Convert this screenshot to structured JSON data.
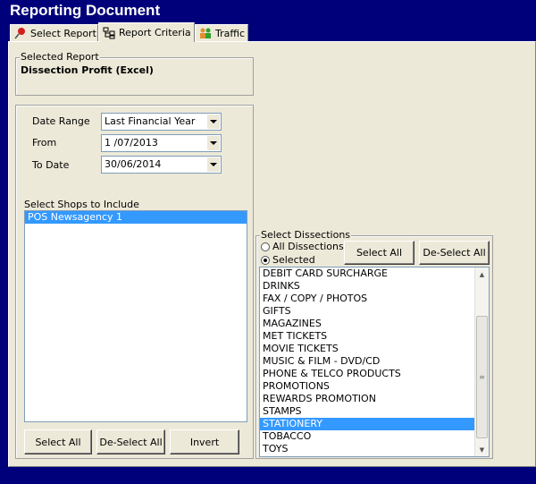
{
  "window": {
    "title": "Reporting Document"
  },
  "tabs": [
    {
      "label": "Select Report",
      "icon": "pin-icon"
    },
    {
      "label": "Report Criteria",
      "icon": "tree-icon"
    },
    {
      "label": "Traffic",
      "icon": "people-icon"
    }
  ],
  "active_tab": "Report Criteria",
  "selected_report": {
    "legend": "Selected Report",
    "name": "Dissection Profit (Excel)"
  },
  "criteria": {
    "date_range": {
      "label": "Date Range",
      "value": "Last Financial Year"
    },
    "from": {
      "label": "From",
      "value": "1 /07/2013"
    },
    "to_date": {
      "label": "To Date",
      "value": "30/06/2014"
    }
  },
  "shops": {
    "label": "Select Shops to Include",
    "items": [
      "POS Newsagency 1"
    ],
    "selected": "POS Newsagency 1",
    "buttons": {
      "select_all": "Select All",
      "deselect_all": "De-Select All",
      "invert": "Invert"
    }
  },
  "dissections": {
    "legend": "Select Dissections",
    "radio_all": "All Dissections",
    "radio_selected": "Selected",
    "radio_value": "Selected",
    "select_all": "Select All",
    "deselect_all": "De-Select All",
    "items": [
      "DEBIT CARD SURCHARGE",
      "DRINKS",
      "FAX / COPY / PHOTOS",
      "GIFTS",
      "MAGAZINES",
      "MET TICKETS",
      "MOVIE TICKETS",
      "MUSIC & FILM - DVD/CD",
      "PHONE & TELCO PRODUCTS",
      "PROMOTIONS",
      "REWARDS PROMOTION",
      "STAMPS",
      "STATIONERY",
      "TOBACCO",
      "TOYS"
    ],
    "selected": "STATIONERY"
  },
  "colors": {
    "titlebar_bg": "#00007a",
    "selection": "#3399ff",
    "panel": "#ece9d8"
  }
}
